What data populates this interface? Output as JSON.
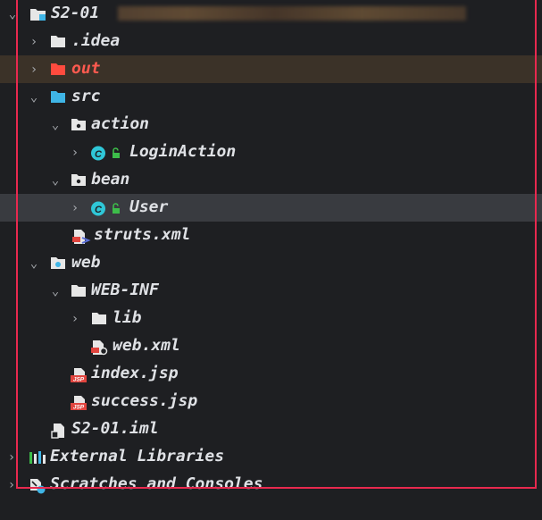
{
  "project": {
    "name": "S2-01"
  },
  "tree": {
    "idea": ".idea",
    "out": "out",
    "src": "src",
    "action": "action",
    "login_action": "LoginAction",
    "bean": "bean",
    "user": "User",
    "struts_xml": "struts.xml",
    "web": "web",
    "web_inf": "WEB-INF",
    "lib": "lib",
    "web_xml": "web.xml",
    "index_jsp": "index.jsp",
    "success_jsp": "success.jsp",
    "iml": "S2-01.iml",
    "external_libraries": "External Libraries",
    "scratches": "Scratches and Consoles"
  },
  "badges": {
    "class_letter": "C",
    "jsp": "JSP"
  },
  "colors": {
    "background": "#1e1f22",
    "selected_row": "#393b40",
    "excluded_row": "#3b3228",
    "excluded_text": "#ff5a4f",
    "highlight_frame": "#e8294f",
    "folder": "#e6e6e6",
    "source_folder": "#3fb5e6",
    "class_badge": "#2fc7d8",
    "access_lock": "#3dbd4a"
  },
  "icons": {
    "chevron_right": "chevron-right-icon",
    "chevron_down": "chevron-down-icon",
    "folder": "folder-icon",
    "package": "package-icon",
    "class": "class-icon",
    "xml": "xml-file-icon",
    "jsp": "jsp-file-icon"
  }
}
